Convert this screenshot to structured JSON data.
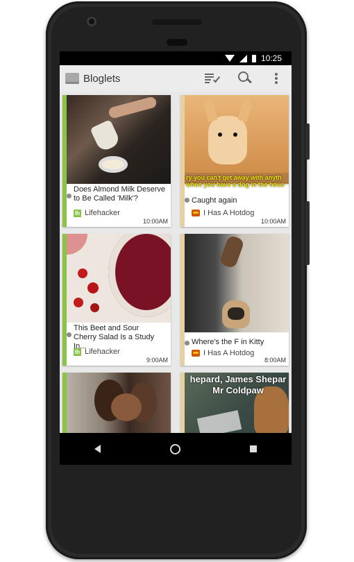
{
  "statusbar": {
    "time": "10:25"
  },
  "app": {
    "title": "Bloglets",
    "icons": {
      "logo": "folder-icon",
      "mark_read": "checklist-icon",
      "search": "search-icon",
      "menu": "more-vert-icon"
    }
  },
  "colors": {
    "accent_green": "#8bc34a",
    "accent_tan": "#e6cfa0",
    "appbar_bg": "#ececec"
  },
  "cards": [
    {
      "headline": "Does Almond Milk Deserve\nto Be Called 'Milk'?",
      "source": "Lifehacker",
      "source_icon": "lifehacker-icon",
      "time": "10:00AM"
    },
    {
      "headline": "Caught again",
      "source": "I Has A Hotdog",
      "source_icon": "hotdog-icon",
      "time": "10:00AM",
      "image_caption": "ry you can't get away with anyth\nwhen you have a dog in the hous"
    },
    {
      "headline": "This Beet and Sour\nCherry Salad Is a Study In...",
      "source": "Lifehacker",
      "source_icon": "lifehacker-icon",
      "time": "9:00AM"
    },
    {
      "headline": "Where's the F in Kitty",
      "source": "I Has A Hotdog",
      "source_icon": "hotdog-icon",
      "time": "8:00AM"
    },
    {
      "headline": "",
      "source": "",
      "time": ""
    },
    {
      "headline": "",
      "source": "",
      "time": "",
      "image_caption": "hepard, James Shepar\nMr Coldpaw"
    }
  ],
  "navbar": {
    "back": "back-icon",
    "home": "home-icon",
    "recents": "recents-icon"
  }
}
